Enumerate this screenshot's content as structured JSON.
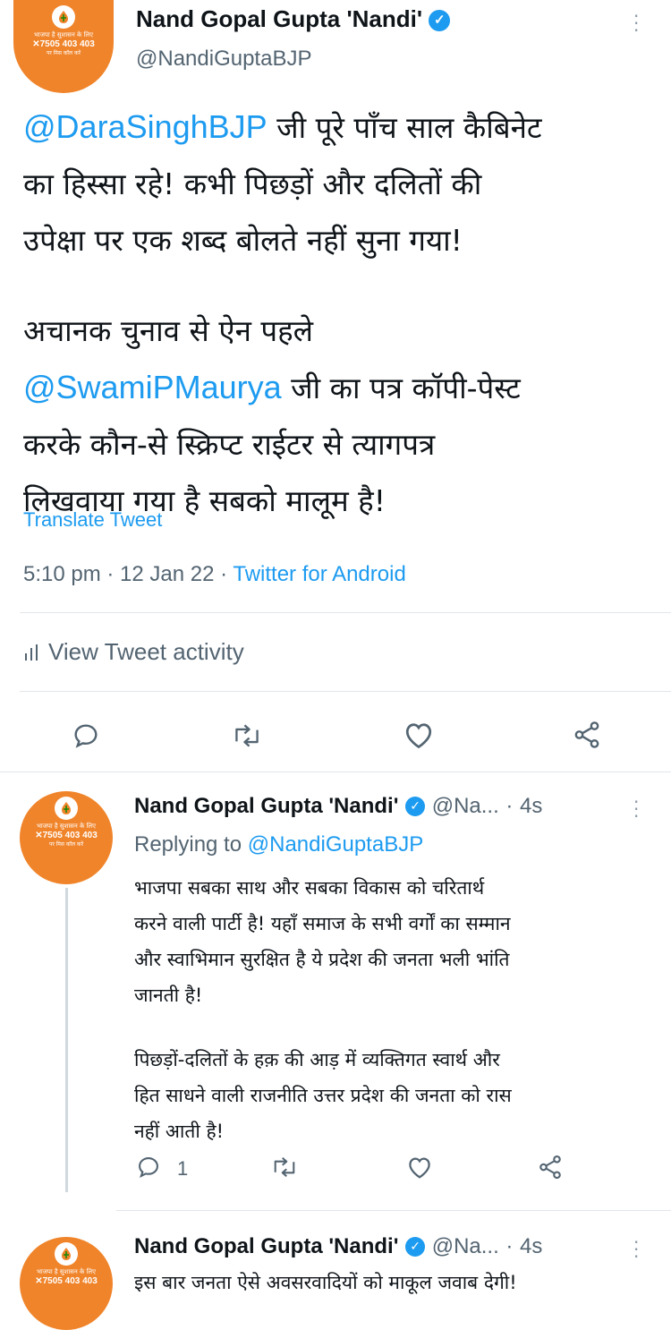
{
  "main_tweet": {
    "author_name": "Nand Gopal Gupta 'Nandi'",
    "handle": "@NandiGuptaBJP",
    "avatar": {
      "tagline": "भाजपा है सुशासन के लिए",
      "phone": "7505 403 403",
      "tagline2": "पर मिस कॉल करें"
    },
    "text": {
      "line1_mention": "@DaraSinghBJP",
      "line1_rest": " जी पूरे पाँच साल कैबिनेट",
      "line2": "का हिस्सा रहे! कभी पिछड़ों और दलितों की",
      "line3": "उपेक्षा पर एक शब्द बोलते नहीं सुना गया!",
      "line4": "अचानक चुनाव से ऐन पहले",
      "line5_mention": "@SwamiPMaurya",
      "line5_rest": " जी का पत्र कॉपी-पेस्ट",
      "line6": "करके कौन-से स्क्रिप्ट राईटर से त्यागपत्र",
      "line7": "लिखवाया गया है सबको मालूम है!"
    },
    "translate": "Translate Tweet",
    "time": "5:10 pm",
    "date": "12 Jan 22",
    "source": "Twitter for Android",
    "activity": "View Tweet activity"
  },
  "reply1": {
    "author_name": "Nand Gopal Gupta 'Nandi'",
    "handle": "@Na...",
    "age": "4s",
    "replying_prefix": "Replying to ",
    "replying_handle": "@NandiGuptaBJP",
    "lines": [
      "भाजपा सबका साथ और सबका विकास को चरितार्थ",
      "करने वाली पार्टी है! यहाँ समाज के सभी वर्गों का सम्मान",
      "और स्वाभिमान सुरक्षित है ये प्रदेश की जनता भली भांति",
      "जानती है!",
      "पिछड़ों-दलितों के हक़ की आड़ में व्यक्तिगत स्वार्थ और",
      "हित साधने वाली राजनीति उत्तर प्रदेश की जनता को रास",
      "नहीं आती है!"
    ],
    "reply_count": "1"
  },
  "reply2": {
    "author_name": "Nand Gopal Gupta 'Nandi'",
    "handle": "@Na...",
    "age": "4s",
    "line": "इस बार जनता ऐसे अवसरवादियों को माकूल जवाब देगी!"
  },
  "colors": {
    "link": "#1d9bf0",
    "secondary_text": "#536471",
    "avatar_bg": "#f0842a"
  },
  "icons": [
    "verified-badge-icon",
    "more-icon",
    "reply-icon",
    "retweet-icon",
    "like-icon",
    "share-icon",
    "activity-bars-icon"
  ]
}
